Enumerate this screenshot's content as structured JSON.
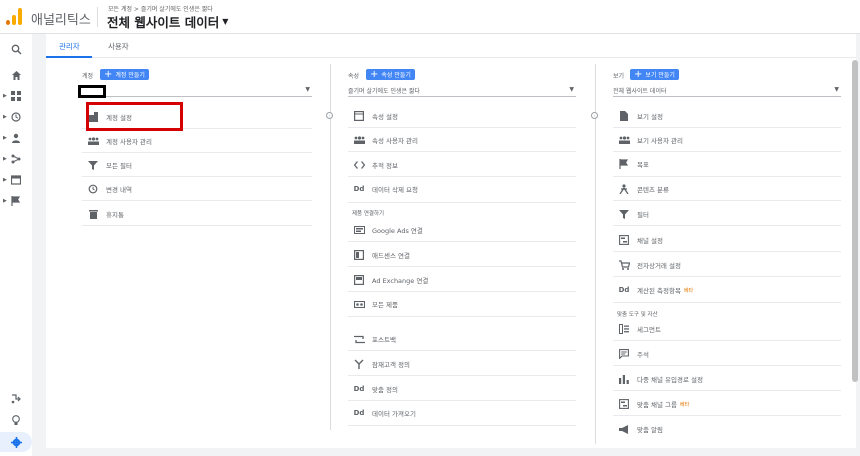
{
  "header": {
    "app_name": "애널리틱스",
    "breadcrumb": "모든 계정 > 즐기며 살기에도 인생은 짧다",
    "view_name": "전체 웹사이트 데이터"
  },
  "tabs": [
    {
      "label": "관리자",
      "active": true
    },
    {
      "label": "사용자",
      "active": false
    }
  ],
  "account": {
    "heading": "계정",
    "create_label": "계정 만들기",
    "selected": "",
    "items": [
      {
        "label": "계정 설정",
        "icon": "building-icon"
      },
      {
        "label": "계정 사용자 관리",
        "icon": "people-icon"
      },
      {
        "label": "모든 필터",
        "icon": "filter-icon"
      },
      {
        "label": "변경 내역",
        "icon": "history-icon"
      },
      {
        "label": "휴지통",
        "icon": "trash-icon"
      }
    ]
  },
  "property": {
    "heading": "속성",
    "create_label": "속성 만들기",
    "selected": "즐기며 살기에도 인생은 짧다",
    "items": [
      {
        "label": "속성 설정",
        "icon": "window-icon"
      },
      {
        "label": "속성 사용자 관리",
        "icon": "people-icon"
      },
      {
        "label": "추적 정보",
        "icon": "code-icon"
      },
      {
        "label": "데이터 삭제 요청",
        "icon": "dd-icon"
      }
    ],
    "links_heading": "제품 연결하기",
    "links": [
      {
        "label": "Google Ads 연결",
        "icon": "ads-icon"
      },
      {
        "label": "애드센스 연결",
        "icon": "adsense-icon"
      },
      {
        "label": "Ad Exchange 연결",
        "icon": "adx-icon"
      },
      {
        "label": "모든 제품",
        "icon": "products-icon"
      }
    ],
    "extra": [
      {
        "label": "포스트백",
        "icon": "postback-icon"
      },
      {
        "label": "잠재고객 정의",
        "icon": "audience-icon"
      },
      {
        "label": "맞춤 정의",
        "icon": "dd-icon"
      },
      {
        "label": "데이터 가져오기",
        "icon": "dd-icon"
      }
    ]
  },
  "view": {
    "heading": "보기",
    "create_label": "보기 만들기",
    "selected": "전체 웹사이트 데이터",
    "items": [
      {
        "label": "보기 설정",
        "icon": "document-icon"
      },
      {
        "label": "보기 사용자 관리",
        "icon": "people-icon"
      },
      {
        "label": "목표",
        "icon": "flag-icon"
      },
      {
        "label": "콘텐츠 분류",
        "icon": "person-icon"
      },
      {
        "label": "필터",
        "icon": "filter-icon"
      },
      {
        "label": "채널 설정",
        "icon": "channel-icon"
      },
      {
        "label": "전자상거래 설정",
        "icon": "cart-icon"
      },
      {
        "label": "계산된 측정항목",
        "icon": "dd-icon",
        "badge": "베타"
      }
    ],
    "tools_heading": "맞춤 도구 및 자산",
    "tools": [
      {
        "label": "세그먼트",
        "icon": "segment-icon"
      },
      {
        "label": "주석",
        "icon": "comment-icon"
      },
      {
        "label": "다중 채널 유입경로 설정",
        "icon": "bars-icon"
      },
      {
        "label": "맞춤 채널 그룹",
        "icon": "channel-icon",
        "badge": "베타"
      },
      {
        "label": "맞춤 알림",
        "icon": "megaphone-icon"
      }
    ]
  },
  "colors": {
    "accent": "#1a73e8",
    "button": "#4285f4",
    "highlight": "#d50000",
    "logo_orange": "#f9ab00",
    "logo_dark": "#e37400"
  }
}
